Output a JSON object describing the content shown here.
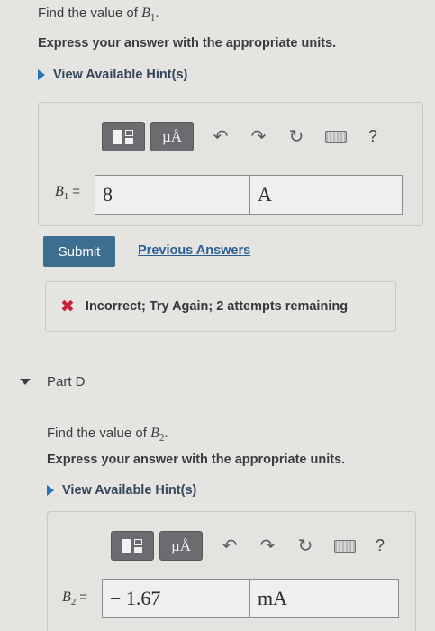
{
  "partC": {
    "question_prefix": "Find the value of ",
    "var": "B",
    "var_sub": "1",
    "question_suffix": ".",
    "instruction": "Express your answer with the appropriate units.",
    "hint": "View Available Hint(s)",
    "answer_label_var": "B",
    "answer_label_sub": "1",
    "equals": "=",
    "value": "8",
    "units": "A"
  },
  "toolbar": {
    "units_label": "µÅ",
    "help": "?"
  },
  "actions": {
    "submit": "Submit",
    "previous": "Previous Answers"
  },
  "alert": {
    "text": "Incorrect; Try Again; 2 attempts remaining"
  },
  "partD": {
    "title": "Part D",
    "question_prefix": "Find the value of ",
    "var": "B",
    "var_sub": "2",
    "question_suffix": ".",
    "instruction": "Express your answer with the appropriate units.",
    "hint": "View Available Hint(s)",
    "answer_label_var": "B",
    "answer_label_sub": "2",
    "equals": "=",
    "value": "− 1.67",
    "units": "mA"
  },
  "colors": {
    "submit_bg": "#3c6f8f",
    "link": "#2c5f95",
    "error": "#c8233a",
    "hint_triangle": "#2a72b8"
  }
}
